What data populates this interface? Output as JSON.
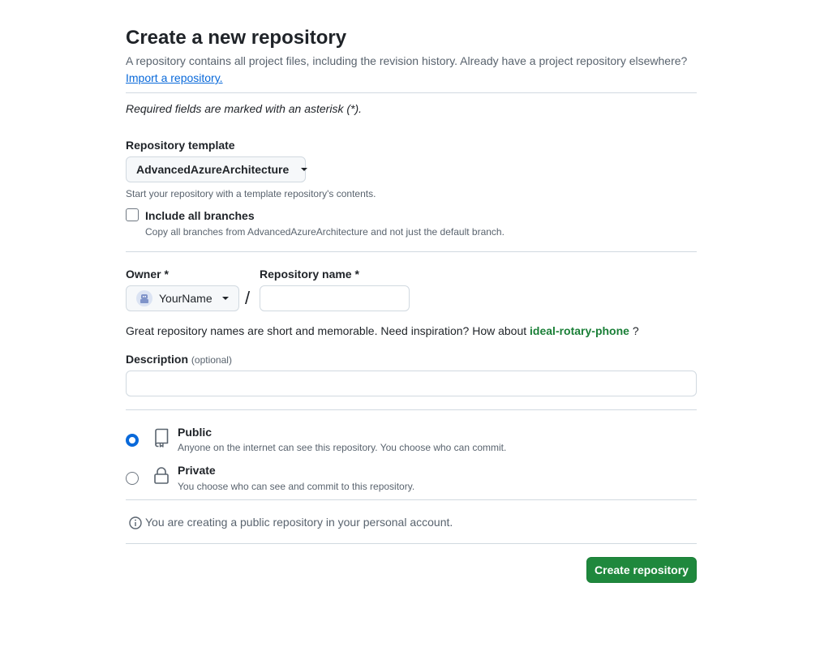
{
  "page": {
    "title": "Create a new repository",
    "intro": "A repository contains all project files, including the revision history. Already have a project repository elsewhere?",
    "import_link": "Import a repository.",
    "required_note": "Required fields are marked with an asterisk (*)."
  },
  "template": {
    "label": "Repository template",
    "selected": "AdvancedAzureArchitecture",
    "note": "Start your repository with a template repository's contents.",
    "include_branches_label": "Include all branches",
    "include_branches_checked": false,
    "include_branches_note": "Copy all branches from AdvancedAzureArchitecture and not just the default branch."
  },
  "owner": {
    "label": "Owner *",
    "selected": "YourName",
    "separator": "/"
  },
  "repo_name": {
    "label": "Repository name *",
    "value": "",
    "suggestion_prefix": "Great repository names are short and memorable. Need inspiration? How about",
    "suggestion": "ideal-rotary-phone",
    "suggestion_suffix": "?"
  },
  "description": {
    "label": "Description",
    "optional": "(optional)",
    "value": ""
  },
  "visibility": {
    "selected": "public",
    "options": [
      {
        "title": "Public",
        "desc": "Anyone on the internet can see this repository. You choose who can commit.",
        "icon": "repo-icon"
      },
      {
        "title": "Private",
        "desc": "You choose who can see and commit to this repository.",
        "icon": "lock-icon"
      }
    ]
  },
  "info": {
    "text": "You are creating a public repository in your personal account.",
    "icon": "info-icon"
  },
  "actions": {
    "create_label": "Create repository"
  },
  "colors": {
    "primary_button": "#1f883d",
    "link": "#0969da",
    "suggestion": "#1a7f37",
    "radio_selected": "#0969da"
  }
}
